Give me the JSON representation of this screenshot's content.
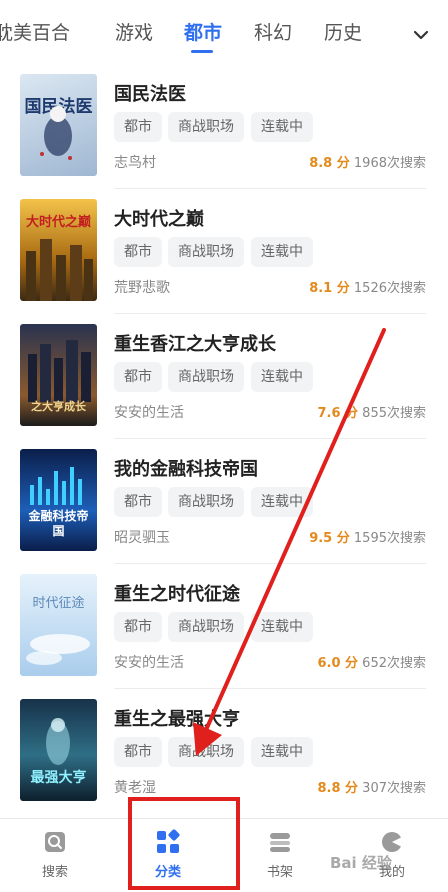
{
  "tabs": {
    "items": [
      "耽美百合",
      "游戏",
      "都市",
      "科幻",
      "历史"
    ],
    "active_index": 2
  },
  "books": [
    {
      "title": "国民法医",
      "cover_text": "国民法医",
      "tags": [
        "都市",
        "商战职场",
        "连载中"
      ],
      "author": "志鸟村",
      "score": "8.8 分",
      "searches": "1968次搜索"
    },
    {
      "title": "大时代之巅",
      "cover_text": "大时代之巅",
      "tags": [
        "都市",
        "商战职场",
        "连载中"
      ],
      "author": "荒野悲歌",
      "score": "8.1 分",
      "searches": "1526次搜索"
    },
    {
      "title": "重生香江之大亨成长",
      "cover_text": "之大亨成长",
      "tags": [
        "都市",
        "商战职场",
        "连载中"
      ],
      "author": "安安的生活",
      "score": "7.6 分",
      "searches": "855次搜索"
    },
    {
      "title": "我的金融科技帝国",
      "cover_text": "金融科技帝国",
      "tags": [
        "都市",
        "商战职场",
        "连载中"
      ],
      "author": "昭灵驷玉",
      "score": "9.5 分",
      "searches": "1595次搜索"
    },
    {
      "title": "重生之时代征途",
      "cover_text": "时代征途",
      "tags": [
        "都市",
        "商战职场",
        "连载中"
      ],
      "author": "安安的生活",
      "score": "6.0 分",
      "searches": "652次搜索"
    },
    {
      "title": "重生之最强大亨",
      "cover_text": "最强大亨",
      "tags": [
        "都市",
        "商战职场",
        "连载中"
      ],
      "author": "黄老湿",
      "score": "8.8 分",
      "searches": "307次搜索"
    }
  ],
  "bottom_nav": {
    "search_label": "搜索",
    "category_label": "分类",
    "shelf_label": "书架",
    "profile_label": "我的"
  },
  "watermark": "Bai 经验",
  "colors": {
    "accent": "#2f6ff0",
    "score": "#e48a1d",
    "annotation": "#e0201c"
  }
}
